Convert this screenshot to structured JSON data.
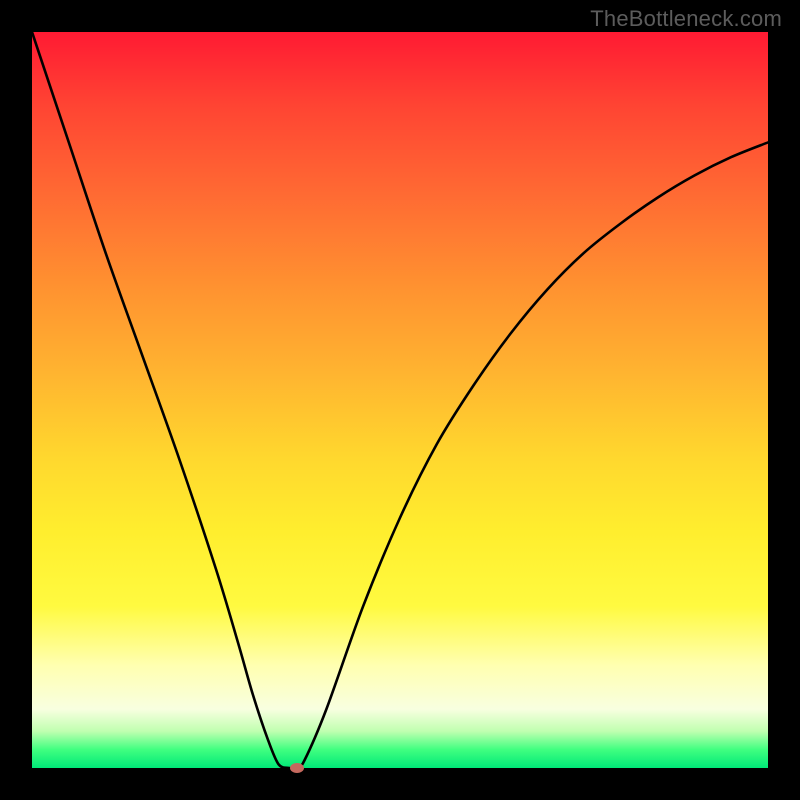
{
  "watermark": "TheBottleneck.com",
  "chart_data": {
    "type": "line",
    "title": "",
    "xlabel": "",
    "ylabel": "",
    "xlim": [
      0,
      100
    ],
    "ylim": [
      0,
      100
    ],
    "grid": false,
    "legend": false,
    "background": "rainbow-gradient-bottleneck",
    "series": [
      {
        "name": "bottleneck-curve",
        "color": "#000000",
        "x": [
          0,
          5,
          10,
          15,
          20,
          25,
          28,
          30,
          32,
          33.5,
          35,
          36,
          37,
          40,
          45,
          50,
          55,
          60,
          65,
          70,
          75,
          80,
          85,
          90,
          95,
          100
        ],
        "y": [
          100,
          85,
          70,
          56,
          42,
          27,
          17,
          10,
          4,
          0.5,
          0,
          0,
          1,
          8,
          22,
          34,
          44,
          52,
          59,
          65,
          70,
          74,
          77.5,
          80.5,
          83,
          85
        ]
      }
    ],
    "marker": {
      "x": 36,
      "y": 0,
      "color": "#c5695e"
    }
  }
}
